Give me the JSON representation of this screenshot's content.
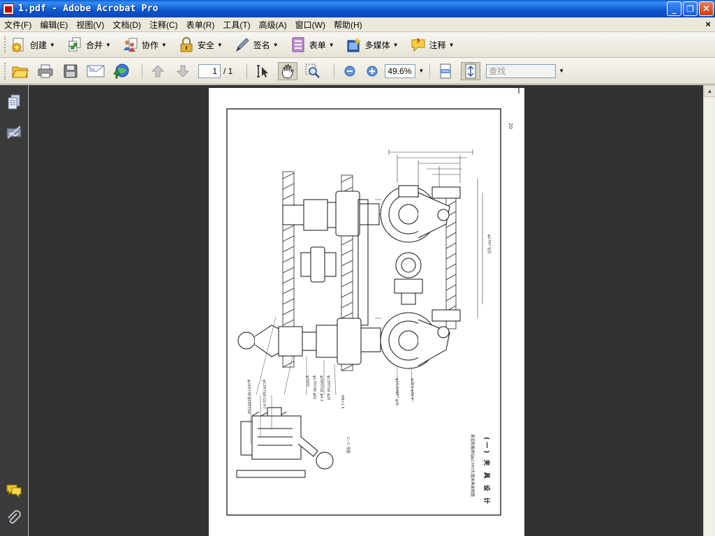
{
  "window": {
    "title": "1.pdf - Adobe Acrobat Pro"
  },
  "menu": [
    "文件(F)",
    "编辑(E)",
    "视图(V)",
    "文档(D)",
    "注释(C)",
    "表单(R)",
    "工具(T)",
    "高级(A)",
    "窗口(W)",
    "帮助(H)"
  ],
  "menu_close": "×",
  "toolbar1": [
    {
      "label": "创建",
      "icon": "create-icon"
    },
    {
      "label": "合并",
      "icon": "combine-icon"
    },
    {
      "label": "协作",
      "icon": "collaborate-icon"
    },
    {
      "label": "安全",
      "icon": "lock-icon"
    },
    {
      "label": "签名",
      "icon": "pen-icon"
    },
    {
      "label": "表单",
      "icon": "form-icon"
    },
    {
      "label": "多媒体",
      "icon": "multimedia-icon"
    },
    {
      "label": "注释",
      "icon": "comment-icon"
    }
  ],
  "nav": {
    "current_page": "1",
    "total_pages": "/ 1",
    "zoom": "49.6%"
  },
  "search": {
    "placeholder": "查找"
  },
  "drawing_text": {
    "page_num": "20",
    "title_vertical": "(一) 夹 具 设 计",
    "caption_vertical": "某齿轮箱体钻φ17H7孔镗夹具装配图"
  },
  "colors": {
    "titlebar": "#0b57d0",
    "doc_background": "#323232",
    "nav_panel": "#3b3b3b"
  }
}
